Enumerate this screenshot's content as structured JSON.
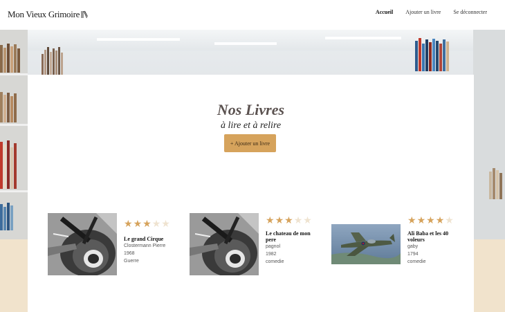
{
  "header": {
    "logo_text": "Mon Vieux Grimoire",
    "nav": [
      {
        "label": "Accueil",
        "active": true
      },
      {
        "label": "Ajouter un livre",
        "active": false
      },
      {
        "label": "Se déconnecter",
        "active": false
      }
    ]
  },
  "main": {
    "title": "Nos Livres",
    "subtitle": "à lire et à relire",
    "add_button": "+ Ajouter un livre"
  },
  "books": [
    {
      "title": "Le grand Cirque",
      "author": "Clostermann Pierre",
      "year": "1968",
      "genre": "Guerre",
      "rating": 3,
      "max_rating": 5,
      "image": "bw-airplane-photo"
    },
    {
      "title": "Le chateau de mon pere",
      "author": "pagnol",
      "year": "1982",
      "genre": "comedie",
      "rating": 3,
      "max_rating": 5,
      "image": "bw-airplane-photo"
    },
    {
      "title": "Ali Baba et les 40 voleurs",
      "author": "gaby",
      "year": "1794",
      "genre": "comedie",
      "rating": 4,
      "max_rating": 5,
      "image": "color-airplane-photo"
    }
  ],
  "colors": {
    "accent": "#d6a35c",
    "background": "#f1e3cc",
    "star_empty": "#efe3d0"
  }
}
